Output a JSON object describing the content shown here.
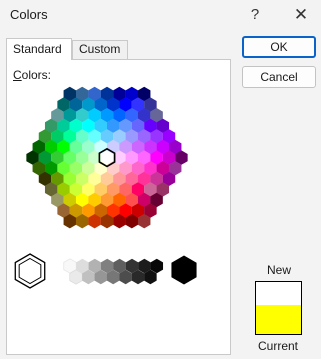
{
  "window": {
    "title": "Colors",
    "help_glyph": "?",
    "close_glyph": "✕"
  },
  "tabs": [
    {
      "label": "Standard",
      "active": true
    },
    {
      "label": "Custom",
      "active": false
    }
  ],
  "colors_label_prefix": "C",
  "colors_label_rest": "olors:",
  "buttons": {
    "ok": "OK",
    "cancel": "Cancel"
  },
  "preview": {
    "new_label": "New",
    "current_label": "Current",
    "new_color": "#ffffff",
    "current_color": "#ffff00"
  },
  "palette": {
    "rows": [
      [
        "#003366",
        "#336699",
        "#3366cc",
        "#003399",
        "#000099",
        "#0000cc",
        "#000066"
      ],
      [
        "#006666",
        "#006699",
        "#0099cc",
        "#0066cc",
        "#0033cc",
        "#0000ff",
        "#3333ff",
        "#333399"
      ],
      [
        "#669999",
        "#009999",
        "#33cccc",
        "#00ccff",
        "#0099ff",
        "#0066ff",
        "#3366ff",
        "#3333cc",
        "#666699"
      ],
      [
        "#339966",
        "#00cc99",
        "#00ffcc",
        "#00ffff",
        "#33ccff",
        "#3399ff",
        "#6699ff",
        "#6666ff",
        "#6600ff",
        "#6600cc"
      ],
      [
        "#339933",
        "#00cc66",
        "#00ff99",
        "#66ffcc",
        "#66ffff",
        "#66ccff",
        "#99ccff",
        "#9999ff",
        "#9966ff",
        "#9933ff",
        "#9900ff"
      ],
      [
        "#006600",
        "#00cc00",
        "#00ff00",
        "#66ff99",
        "#99ffcc",
        "#ccffff",
        "#ccccff",
        "#cc99ff",
        "#cc66ff",
        "#cc33ff",
        "#cc00ff",
        "#9900cc"
      ],
      [
        "#003300",
        "#009933",
        "#33cc33",
        "#66ff66",
        "#99ff99",
        "#ccffcc",
        "#ffffff",
        "#ffccff",
        "#ff99ff",
        "#ff66ff",
        "#ff00ff",
        "#cc00cc",
        "#660066"
      ],
      [
        "#336600",
        "#009900",
        "#66ff33",
        "#99ff66",
        "#ccff99",
        "#ffffcc",
        "#ffcccc",
        "#ff99cc",
        "#ff66cc",
        "#ff33cc",
        "#cc0099",
        "#993399"
      ],
      [
        "#333300",
        "#669900",
        "#99ff33",
        "#ccff66",
        "#ffff99",
        "#ffcc99",
        "#ff9999",
        "#ff6699",
        "#ff3399",
        "#cc3399",
        "#990099"
      ],
      [
        "#666633",
        "#99cc00",
        "#ccff33",
        "#ffff66",
        "#ffcc66",
        "#ff9966",
        "#ff6666",
        "#ff0066",
        "#cc6699",
        "#993366"
      ],
      [
        "#999966",
        "#cccc00",
        "#ffff00",
        "#ffcc00",
        "#ff9933",
        "#ff6600",
        "#ff5050",
        "#cc0066",
        "#660033"
      ],
      [
        "#996633",
        "#cc9900",
        "#ff9900",
        "#cc6600",
        "#ff3300",
        "#ff0000",
        "#cc0000",
        "#990033"
      ],
      [
        "#663300",
        "#996600",
        "#cc3300",
        "#993300",
        "#990000",
        "#800000",
        "#993333"
      ]
    ],
    "grays_top": [
      "#f8f8f8",
      "#dddddd",
      "#b2b2b2",
      "#808080",
      "#5f5f5f",
      "#333333",
      "#1c1c1c",
      "#080808"
    ],
    "grays_bottom": [
      "#eaeaea",
      "#c0c0c0",
      "#969696",
      "#777777",
      "#4d4d4d",
      "#292929",
      "#111111"
    ],
    "white": "#ffffff",
    "black": "#000000"
  }
}
